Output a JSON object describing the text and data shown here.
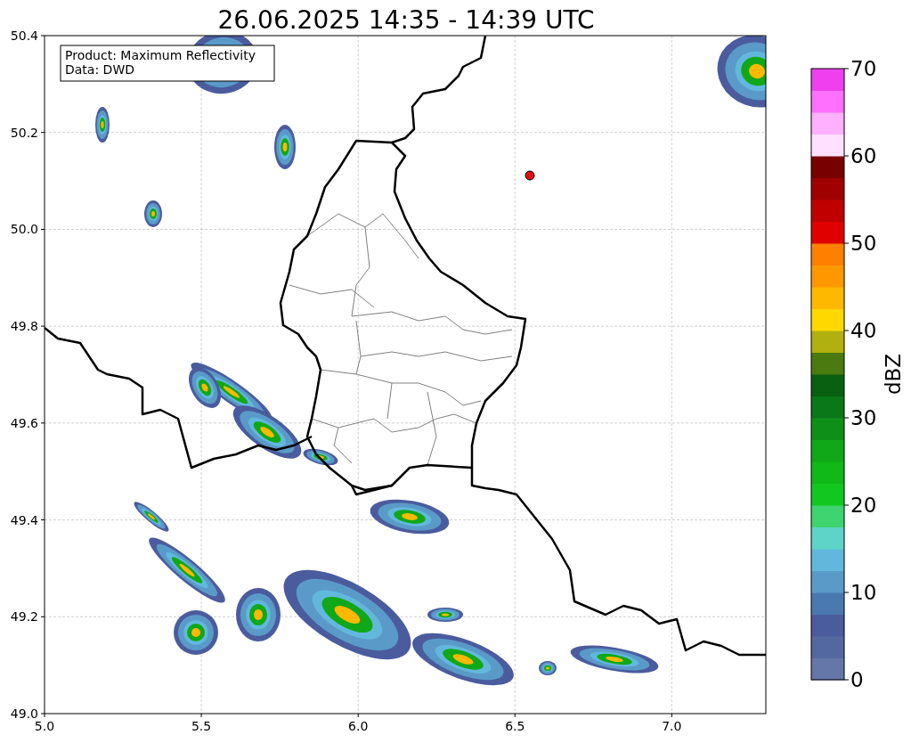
{
  "title": "26.06.2025 14:35 - 14:39 UTC",
  "legend": [
    "Product: Maximum Reflectivity",
    "Data: DWD"
  ],
  "x_ticks": [
    "5.0",
    "5.5",
    "6.0",
    "6.5",
    "7.0"
  ],
  "y_ticks": [
    "50.4",
    "50.2",
    "50.0",
    "49.8",
    "49.6",
    "49.4",
    "49.2",
    "49.0"
  ],
  "colorbar": {
    "label": "dBZ",
    "ticks": [
      "70",
      "60",
      "50",
      "40",
      "30",
      "20",
      "10",
      "0"
    ],
    "bins": [
      {
        "color": "#6577a8"
      },
      {
        "color": "#5468a0"
      },
      {
        "color": "#4a5c9e"
      },
      {
        "color": "#4a78b0"
      },
      {
        "color": "#5a9ac8"
      },
      {
        "color": "#62b8dc"
      },
      {
        "color": "#5ed4c8"
      },
      {
        "color": "#3ed470"
      },
      {
        "color": "#12c820"
      },
      {
        "color": "#10b818"
      },
      {
        "color": "#10a818"
      },
      {
        "color": "#0e9018"
      },
      {
        "color": "#0a7818"
      },
      {
        "color": "#086010"
      },
      {
        "color": "#4a7a10"
      },
      {
        "color": "#b0b010"
      },
      {
        "color": "#ffd800"
      },
      {
        "color": "#ffb800"
      },
      {
        "color": "#ff9800"
      },
      {
        "color": "#ff8000"
      },
      {
        "color": "#e00000"
      },
      {
        "color": "#c00000"
      },
      {
        "color": "#a00000"
      },
      {
        "color": "#780000"
      },
      {
        "color": "#ffe0ff"
      },
      {
        "color": "#ffb0ff"
      },
      {
        "color": "#ff70ff"
      },
      {
        "color": "#ee40ee"
      }
    ]
  }
}
